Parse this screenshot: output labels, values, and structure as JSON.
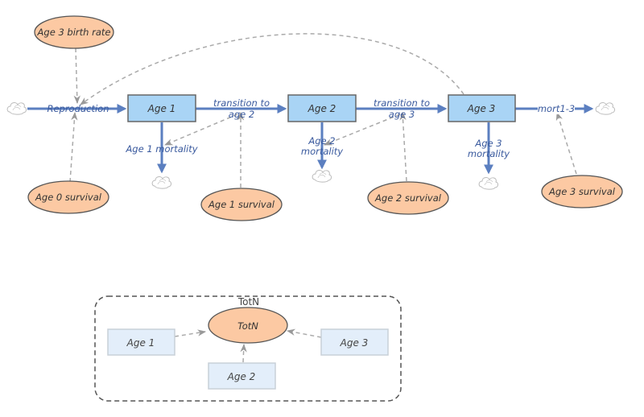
{
  "diagram": {
    "type": "stock-and-flow",
    "stocks": [
      {
        "id": "age1",
        "label": "Age 1"
      },
      {
        "id": "age2",
        "label": "Age 2"
      },
      {
        "id": "age3",
        "label": "Age 3"
      }
    ],
    "flows": [
      {
        "id": "reproduction",
        "label": "Reproduction",
        "from": "cloud",
        "to": "age1"
      },
      {
        "id": "transition2",
        "label_line1": "transition to",
        "label_line2": "age 2",
        "from": "age1",
        "to": "age2"
      },
      {
        "id": "transition3",
        "label_line1": "transition to",
        "label_line2": "age 3",
        "from": "age2",
        "to": "age3"
      },
      {
        "id": "mort13",
        "label": "mort1-3",
        "from": "age3",
        "to": "cloud"
      },
      {
        "id": "age1mort",
        "label": "Age 1 mortality",
        "from": "age1",
        "to": "cloud"
      },
      {
        "id": "age2mort",
        "label_line1": "Age 2",
        "label_line2": "mortality",
        "from": "age2",
        "to": "cloud"
      },
      {
        "id": "age3mort",
        "label_line1": "Age 3",
        "label_line2": "mortality",
        "from": "age3",
        "to": "cloud"
      }
    ],
    "auxiliaries": [
      {
        "id": "birthrate",
        "label": "Age 3 birth rate"
      },
      {
        "id": "age0surv",
        "label": "Age 0 survival"
      },
      {
        "id": "age1surv",
        "label": "Age 1 survival"
      },
      {
        "id": "age2surv",
        "label": "Age 2 survival"
      },
      {
        "id": "age3surv",
        "label": "Age 3 survival"
      }
    ],
    "group": {
      "title": "TotN",
      "converter": "TotN",
      "ghosts": [
        "Age 1",
        "Age 2",
        "Age 3"
      ]
    }
  },
  "colors": {
    "stock_fill": "#a9d4f5",
    "stock_border": "#666666",
    "aux_fill": "#fcc9a3",
    "aux_border": "#555555",
    "flow": "#5b7fc0",
    "link": "#aaaaaa",
    "ghost_fill": "#e3eefa",
    "ghost_border": "#c8d0d8",
    "group_border": "#555555"
  }
}
